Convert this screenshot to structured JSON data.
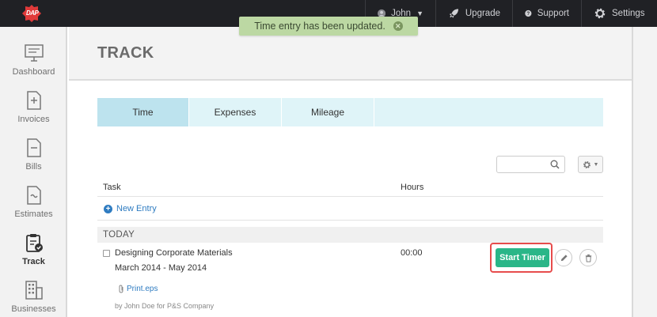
{
  "topbar": {
    "logo_text": "DAP",
    "user_name": "John",
    "upgrade_label": "Upgrade",
    "support_label": "Support",
    "settings_label": "Settings"
  },
  "toast": {
    "message": "Time entry has been updated."
  },
  "sidebar": {
    "items": [
      {
        "label": "Dashboard",
        "icon": "monitor-icon"
      },
      {
        "label": "Invoices",
        "icon": "invoice-icon"
      },
      {
        "label": "Bills",
        "icon": "bill-icon"
      },
      {
        "label": "Estimates",
        "icon": "estimate-icon"
      },
      {
        "label": "Track",
        "icon": "clipboard-check-icon"
      },
      {
        "label": "Businesses",
        "icon": "building-icon"
      }
    ],
    "active": "Track"
  },
  "page": {
    "title": "TRACK"
  },
  "tabs": [
    {
      "label": "Time",
      "active": true
    },
    {
      "label": "Expenses",
      "active": false
    },
    {
      "label": "Mileage",
      "active": false
    }
  ],
  "search": {
    "placeholder": ""
  },
  "table": {
    "headers": {
      "task": "Task",
      "hours": "Hours"
    },
    "new_entry_label": "New Entry",
    "group_label": "TODAY",
    "rows": [
      {
        "task": "Designing Corporate Materials",
        "date_range": "March 2014 - May 2014",
        "hours": "00:00",
        "attachment": "Print.eps",
        "byline": "by John Doe for P&S Company",
        "timer_label": "Start Timer"
      }
    ]
  },
  "colors": {
    "topbar": "#202125",
    "active_tab": "#bde3ee",
    "timer_button": "#2ab688",
    "highlight": "#e74c4c",
    "link": "#2f7cc1",
    "toast": "#bcd8a3"
  }
}
